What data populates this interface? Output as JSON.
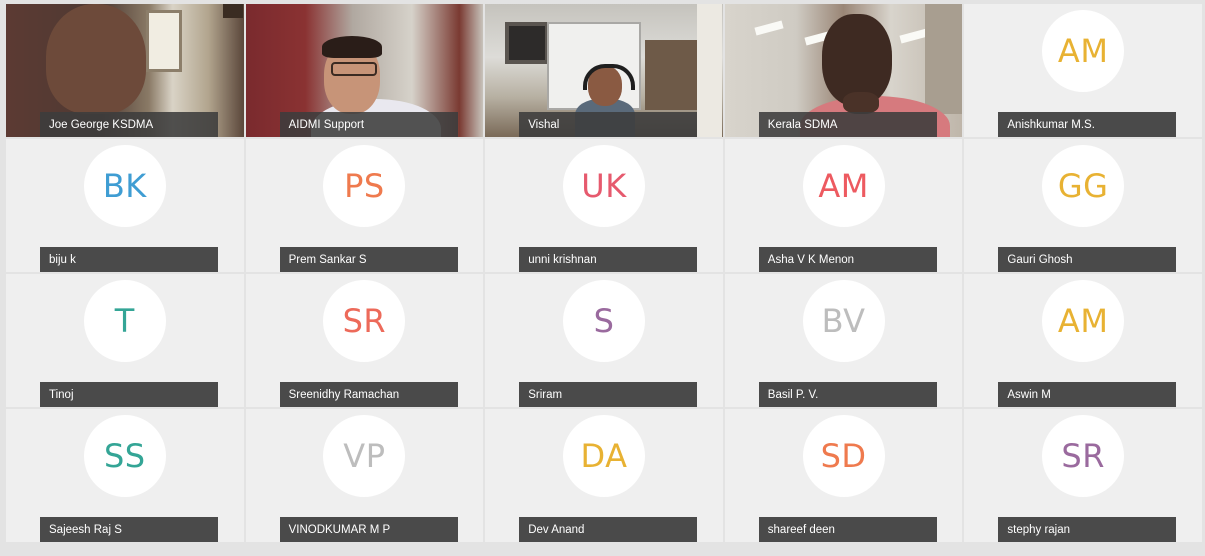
{
  "participants": [
    {
      "name": "Joe George KSDMA",
      "type": "video"
    },
    {
      "name": "AIDMI Support",
      "type": "video"
    },
    {
      "name": "Vishal",
      "type": "video"
    },
    {
      "name": "Kerala SDMA",
      "type": "video"
    },
    {
      "name": "Anishkumar M.S.",
      "type": "avatar",
      "initials": "AM",
      "color": "#e8b233"
    },
    {
      "name": "biju k",
      "type": "avatar",
      "initials": "BK",
      "color": "#3f9dd3"
    },
    {
      "name": "Prem Sankar S",
      "type": "avatar",
      "initials": "PS",
      "color": "#ef7a4e"
    },
    {
      "name": "unni krishnan",
      "type": "avatar",
      "initials": "UK",
      "color": "#e65a6e"
    },
    {
      "name": "Asha V K Menon",
      "type": "avatar",
      "initials": "AM",
      "color": "#ed5a60"
    },
    {
      "name": "Gauri Ghosh",
      "type": "avatar",
      "initials": "GG",
      "color": "#e8b233"
    },
    {
      "name": "Tinoj",
      "type": "avatar",
      "initials": "T",
      "color": "#34a596"
    },
    {
      "name": "Sreenidhy Ramachan",
      "type": "avatar",
      "initials": "SR",
      "color": "#ed6a5a"
    },
    {
      "name": "Sriram",
      "type": "avatar",
      "initials": "S",
      "color": "#9a6a9e"
    },
    {
      "name": "Basil P. V.",
      "type": "avatar",
      "initials": "BV",
      "color": "#bdbdbd"
    },
    {
      "name": "Aswin M",
      "type": "avatar",
      "initials": "AM",
      "color": "#e8b233"
    },
    {
      "name": "Sajeesh Raj S",
      "type": "avatar",
      "initials": "SS",
      "color": "#34a596"
    },
    {
      "name": "VINODKUMAR M P",
      "type": "avatar",
      "initials": "VP",
      "color": "#bdbdbd"
    },
    {
      "name": "Dev Anand",
      "type": "avatar",
      "initials": "DA",
      "color": "#e8b233"
    },
    {
      "name": "shareef deen",
      "type": "avatar",
      "initials": "SD",
      "color": "#ef7a4e"
    },
    {
      "name": "stephy rajan",
      "type": "avatar",
      "initials": "SR",
      "color": "#9a6a9e"
    }
  ]
}
